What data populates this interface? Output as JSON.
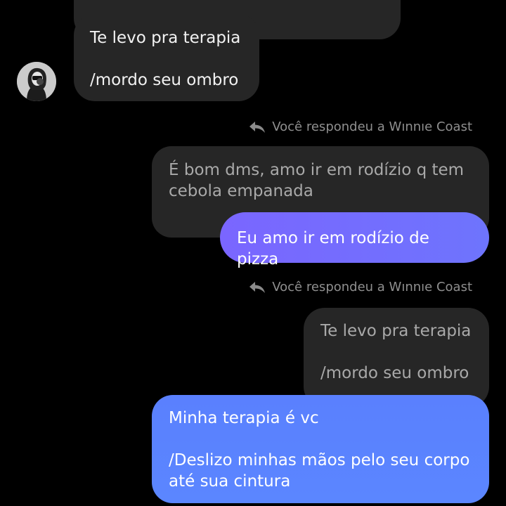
{
  "thread": {
    "incoming": {
      "text": "Te levo pra terapia\n\n/mordo seu ombro",
      "avatar_icon": "avatar-photo"
    },
    "reply_1": {
      "label": "Você respondeu a Wınnıe Coast",
      "quoted_text": "É bom dms, amo ir em rodízio q tem cebola empanada",
      "sent_text": "Eu amo ir em rodízio de pizza"
    },
    "reply_2": {
      "label": "Você respondeu a Wınnıe Coast",
      "quoted_text": "Te levo pra terapia\n\n/mordo seu ombro",
      "sent_text": "Minha terapia é vc\n\n/Deslizo minhas mãos pelo seu corpo até sua cintura"
    }
  },
  "colors": {
    "background": "#000000",
    "incoming_bubble": "#262626",
    "sent_purple": "#7368fe",
    "sent_blue": "#5b84ff",
    "meta_text": "#8f8f8f"
  },
  "icons": {
    "reply": "reply-arrow-icon"
  }
}
